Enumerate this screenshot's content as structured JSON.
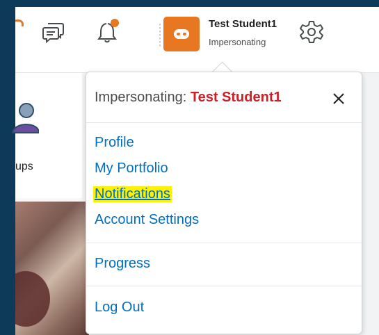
{
  "user": {
    "name": "Test Student1",
    "status": "Impersonating"
  },
  "colors": {
    "accent_orange": "#e87722",
    "link_blue": "#006fbf",
    "name_red": "#cd2026",
    "frame_navy": "#0e3a5a",
    "highlight_yellow": "#fff200"
  },
  "background": {
    "groups_label": "ups"
  },
  "dropdown": {
    "header_prefix": "Impersonating:",
    "header_name": "Test Student1",
    "close_icon": "close-icon",
    "menu_groups": [
      [
        "Profile",
        "My Portfolio",
        "Notifications",
        "Account Settings"
      ],
      [
        "Progress"
      ],
      [
        "Log Out"
      ]
    ],
    "highlighted_item": "Notifications"
  }
}
